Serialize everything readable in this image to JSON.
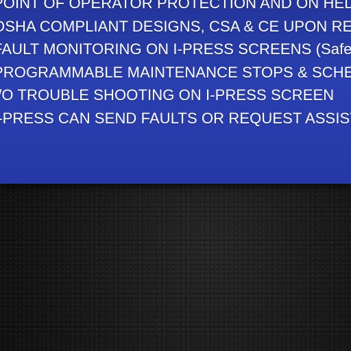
{
  "panel": {
    "bullets": [
      "POINT OF OPERATOR PROTECTION AND ON HELP",
      "OSHA COMPLIANT DESIGNS, CSA & CE UPON RE",
      "FAULT MONITORING ON I-PRESS SCREENS (Safet",
      "PROGRAMMABLE MAINTENANCE STOPS & SCHE",
      "I/O TROUBLE SHOOTING ON I-PRESS SCREEN",
      "I-PRESS CAN SEND FAULTS OR REQUEST ASSISTAN"
    ]
  },
  "colors": {
    "panel_blue": "#2a3fb0",
    "background": "#161616",
    "text": "#ffffff"
  }
}
